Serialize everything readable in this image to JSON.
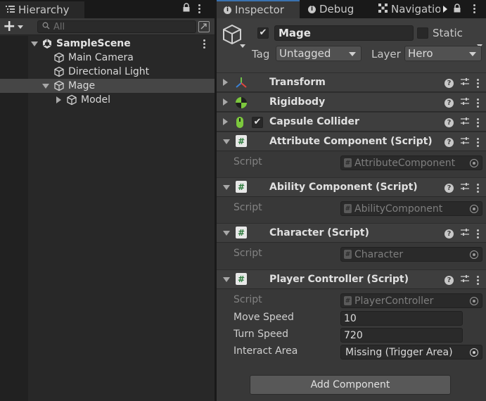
{
  "hierarchy": {
    "tab_label": "Hierarchy",
    "search_placeholder": "All",
    "items": [
      {
        "label": "SampleScene"
      },
      {
        "label": "Main Camera"
      },
      {
        "label": "Directional Light"
      },
      {
        "label": "Mage"
      },
      {
        "label": "Model"
      }
    ]
  },
  "inspector": {
    "tabs": [
      {
        "label": "Inspector"
      },
      {
        "label": "Debug"
      },
      {
        "label": "Navigatio"
      }
    ],
    "gameobject": {
      "active": true,
      "name": "Mage",
      "static_label": "Static",
      "tag_label": "Tag",
      "tag_value": "Untagged",
      "layer_label": "Layer",
      "layer_value": "Hero"
    },
    "components": [
      {
        "title": "Transform"
      },
      {
        "title": "Rigidbody"
      },
      {
        "title": "Capsule Collider"
      },
      {
        "title": "Attribute Component (Script)",
        "script_label": "Script",
        "script_value": "AttributeComponent"
      },
      {
        "title": "Ability Component (Script)",
        "script_label": "Script",
        "script_value": "AbilityComponent"
      },
      {
        "title": "Character (Script)",
        "script_label": "Script",
        "script_value": "Character"
      },
      {
        "title": "Player Controller (Script)",
        "script_label": "Script",
        "script_value": "PlayerController",
        "fields": [
          {
            "label": "Move Speed",
            "value": "10"
          },
          {
            "label": "Turn Speed",
            "value": "720"
          },
          {
            "label": "Interact Area",
            "value": "Missing (Trigger Area)"
          }
        ]
      }
    ],
    "add_component_label": "Add Component"
  },
  "colors": {
    "panel_bg": "#383838",
    "header_bg": "#3e3e3e",
    "hierarchy_bg": "#282828",
    "selection": "#464646",
    "tab_accent": "#3a72b0",
    "script_icon_green": "#2c7a3c"
  }
}
